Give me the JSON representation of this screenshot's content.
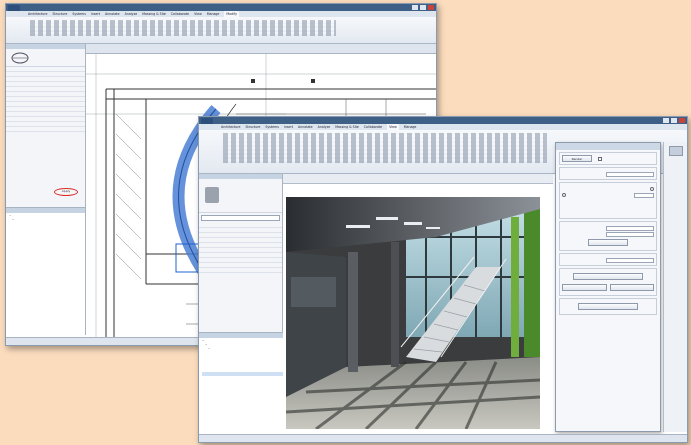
{
  "ribbon_tabs": [
    "Architecture",
    "Structure",
    "Systems",
    "Insert",
    "Annotate",
    "Analyze",
    "Massing & Site",
    "Collaborate",
    "View",
    "Manage",
    "Modify"
  ],
  "window1": {
    "apply_label": "Apply"
  },
  "window2": {
    "dialog": {
      "render_button": "Render"
    }
  }
}
